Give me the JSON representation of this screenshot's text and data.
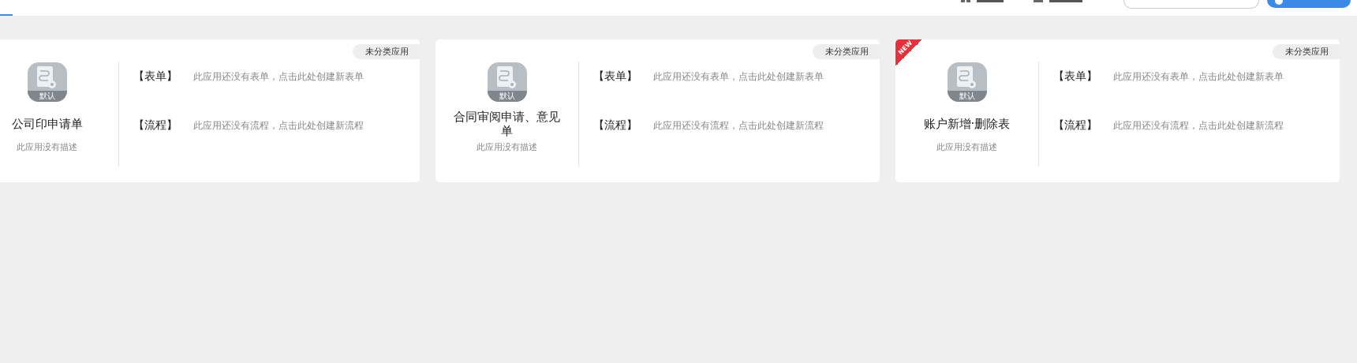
{
  "apps": [
    {
      "title": "公司印申请单",
      "icon_label": "默认",
      "description": "此应用没有描述",
      "category": "未分类应用",
      "sections": [
        {
          "label": "【表单】",
          "hint": "此应用还没有表单，点击此处创建新表单"
        },
        {
          "label": "【流程】",
          "hint": "此应用还没有流程，点击此处创建新流程"
        }
      ]
    },
    {
      "title": "合同审阅申请、意见单",
      "icon_label": "默认",
      "description": "此应用没有描述",
      "category": "未分类应用",
      "sections": [
        {
          "label": "【表单】",
          "hint": "此应用还没有表单，点击此处创建新表单"
        },
        {
          "label": "【流程】",
          "hint": "此应用还没有流程，点击此处创建新流程"
        }
      ]
    },
    {
      "title": "账户新增·删除表",
      "icon_label": "默认",
      "description": "此应用没有描述",
      "category": "未分类应用",
      "badge": "NEW",
      "sections": [
        {
          "label": "【表单】",
          "hint": "此应用还没有表单，点击此处创建新表单"
        },
        {
          "label": "【流程】",
          "hint": "此应用还没有流程，点击此处创建新流程"
        }
      ]
    }
  ]
}
